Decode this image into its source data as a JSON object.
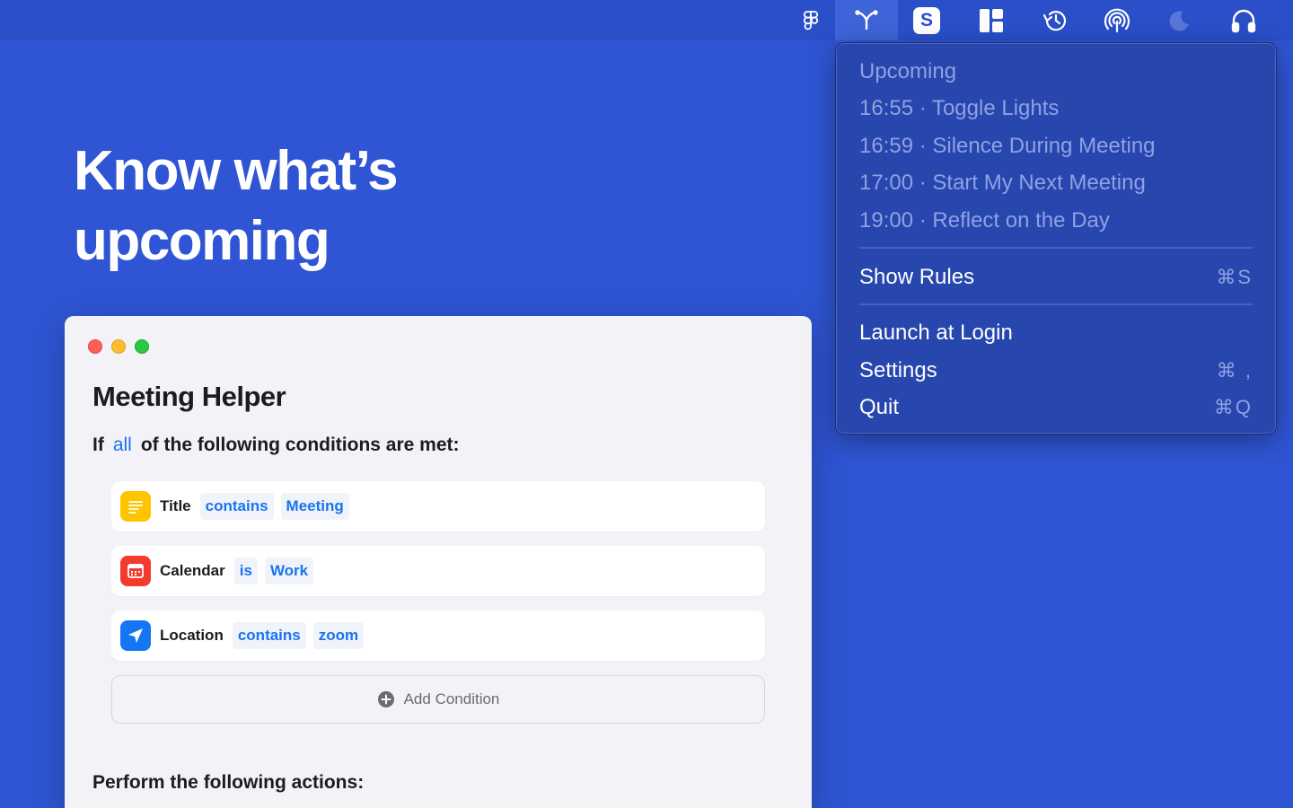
{
  "menubar": {
    "icons": [
      "figma-icon",
      "shortcut-fork-icon",
      "s-app-icon",
      "layout-grid-icon",
      "history-icon",
      "airdrop-icon",
      "moon-icon",
      "headphones-icon"
    ],
    "s_letter": "S"
  },
  "headline": {
    "line1": "Know what’s",
    "line2": "upcoming"
  },
  "window": {
    "title": "Meeting Helper",
    "condition_prefix": "If",
    "condition_mode": "all",
    "condition_suffix": "of the following conditions are met:",
    "conditions": [
      {
        "icon": "notes-icon",
        "label": "Title",
        "operator": "contains",
        "value": "Meeting"
      },
      {
        "icon": "calendar-icon",
        "label": "Calendar",
        "operator": "is",
        "value": "Work"
      },
      {
        "icon": "location-arrow-icon",
        "label": "Location",
        "operator": "contains",
        "value": "zoom"
      }
    ],
    "add_condition_label": "Add Condition",
    "actions_heading": "Perform the following actions:"
  },
  "menu": {
    "upcoming_header": "Upcoming",
    "upcoming_items": [
      "16:55 · Toggle Lights",
      "16:59 · Silence During Meeting",
      "17:00 · Start My Next Meeting",
      "19:00 · Reflect on the Day"
    ],
    "show_rules": {
      "label": "Show Rules",
      "shortcut": "⌘S"
    },
    "launch_at_login": {
      "label": "Launch at Login"
    },
    "settings": {
      "label": "Settings",
      "shortcut": "⌘ ,"
    },
    "quit": {
      "label": "Quit",
      "shortcut": "⌘Q"
    }
  },
  "colors": {
    "background": "#2f55d4",
    "menubar": "#2a4fc9",
    "accent": "#1a73f0",
    "menu_bg": "#2746ae",
    "window_bg": "#f2f2f7"
  }
}
